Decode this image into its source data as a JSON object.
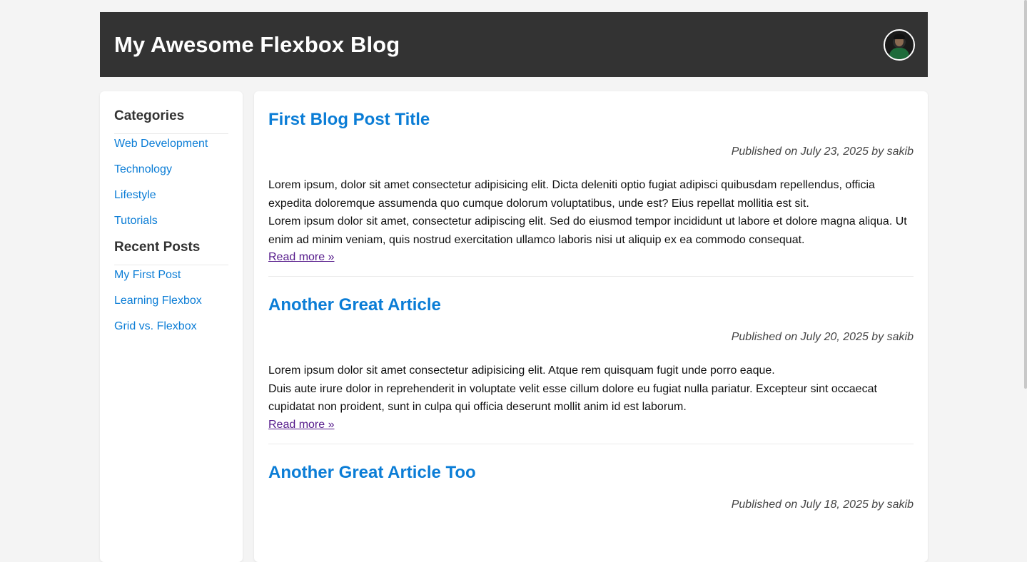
{
  "header": {
    "site_title": "My Awesome Flexbox Blog"
  },
  "sidebar": {
    "categories_heading": "Categories",
    "categories": [
      {
        "label": "Web Development"
      },
      {
        "label": "Technology"
      },
      {
        "label": "Lifestyle"
      },
      {
        "label": "Tutorials"
      }
    ],
    "recent_heading": "Recent Posts",
    "recent_posts": [
      {
        "label": "My First Post"
      },
      {
        "label": "Learning Flexbox"
      },
      {
        "label": "Grid vs. Flexbox"
      }
    ]
  },
  "posts": [
    {
      "title": "First Blog Post Title",
      "meta": "Published on July 23, 2025 by sakib",
      "paragraph1": "Lorem ipsum, dolor sit amet consectetur adipisicing elit. Dicta deleniti optio fugiat adipisci quibusdam repellendus, officia expedita doloremque assumenda quo cumque dolorum voluptatibus, unde est? Eius repellat mollitia est sit.",
      "paragraph2": "Lorem ipsum dolor sit amet, consectetur adipiscing elit. Sed do eiusmod tempor incididunt ut labore et dolore magna aliqua. Ut enim ad minim veniam, quis nostrud exercitation ullamco laboris nisi ut aliquip ex ea commodo consequat.",
      "read_more": "Read more »"
    },
    {
      "title": "Another Great Article",
      "meta": "Published on July 20, 2025 by sakib",
      "paragraph1": "Lorem ipsum dolor sit amet consectetur adipisicing elit. Atque rem quisquam fugit unde porro eaque.",
      "paragraph2": "Duis aute irure dolor in reprehenderit in voluptate velit esse cillum dolore eu fugiat nulla pariatur. Excepteur sint occaecat cupidatat non proident, sunt in culpa qui officia deserunt mollit anim id est laborum.",
      "read_more": "Read more »"
    },
    {
      "title": "Another Great Article Too",
      "meta": "Published on July 18, 2025 by sakib"
    }
  ],
  "colors": {
    "header_bg": "#333333",
    "link": "#0b7dd6",
    "visited_link": "#551a8b",
    "page_bg": "#f4f4f4"
  }
}
